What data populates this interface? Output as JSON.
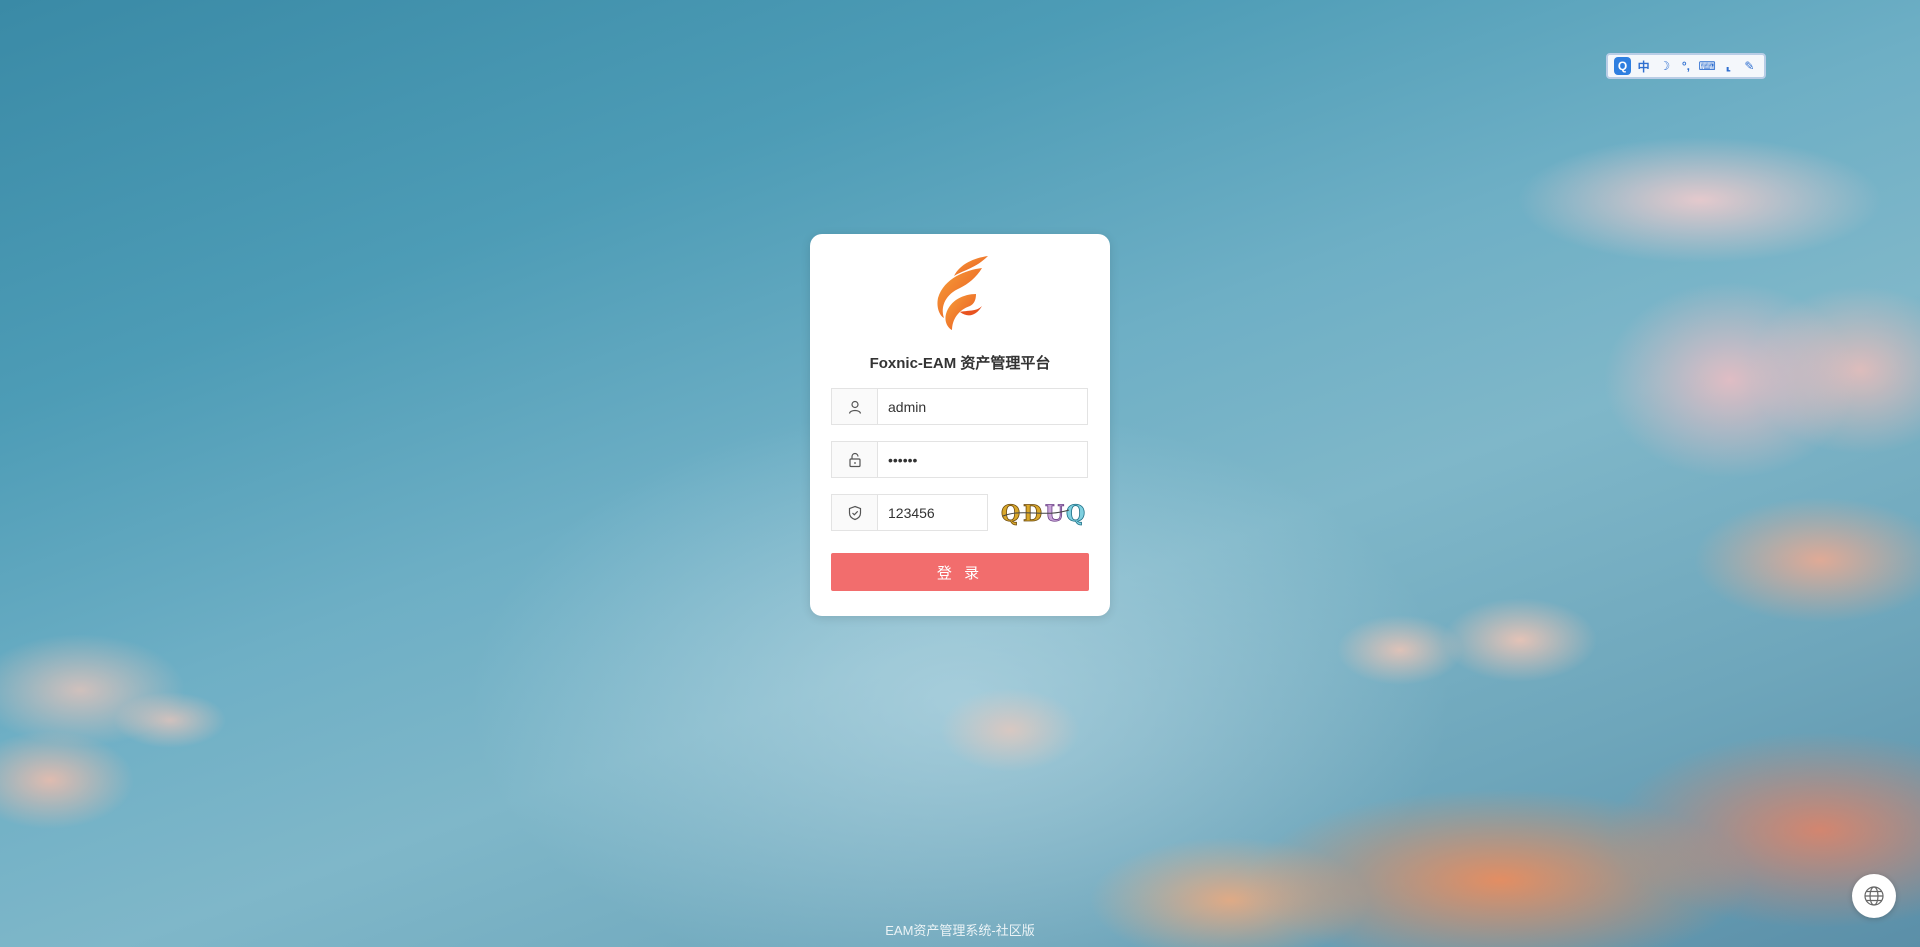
{
  "app": {
    "title": "Foxnic-EAM 资产管理平台",
    "footer": "EAM资产管理系统-社区版"
  },
  "login": {
    "username_value": "admin",
    "password_value": "••••••",
    "captcha_value": "123456",
    "captcha_text": "QDUQ",
    "submit_label": "登 录"
  },
  "ime_toolbar": {
    "items": [
      "中",
      "☽",
      "°,",
      "⌨",
      "⸤",
      "✎"
    ]
  },
  "colors": {
    "primary_button": "#f26d6d",
    "logo_orange": "#f07a2a"
  }
}
